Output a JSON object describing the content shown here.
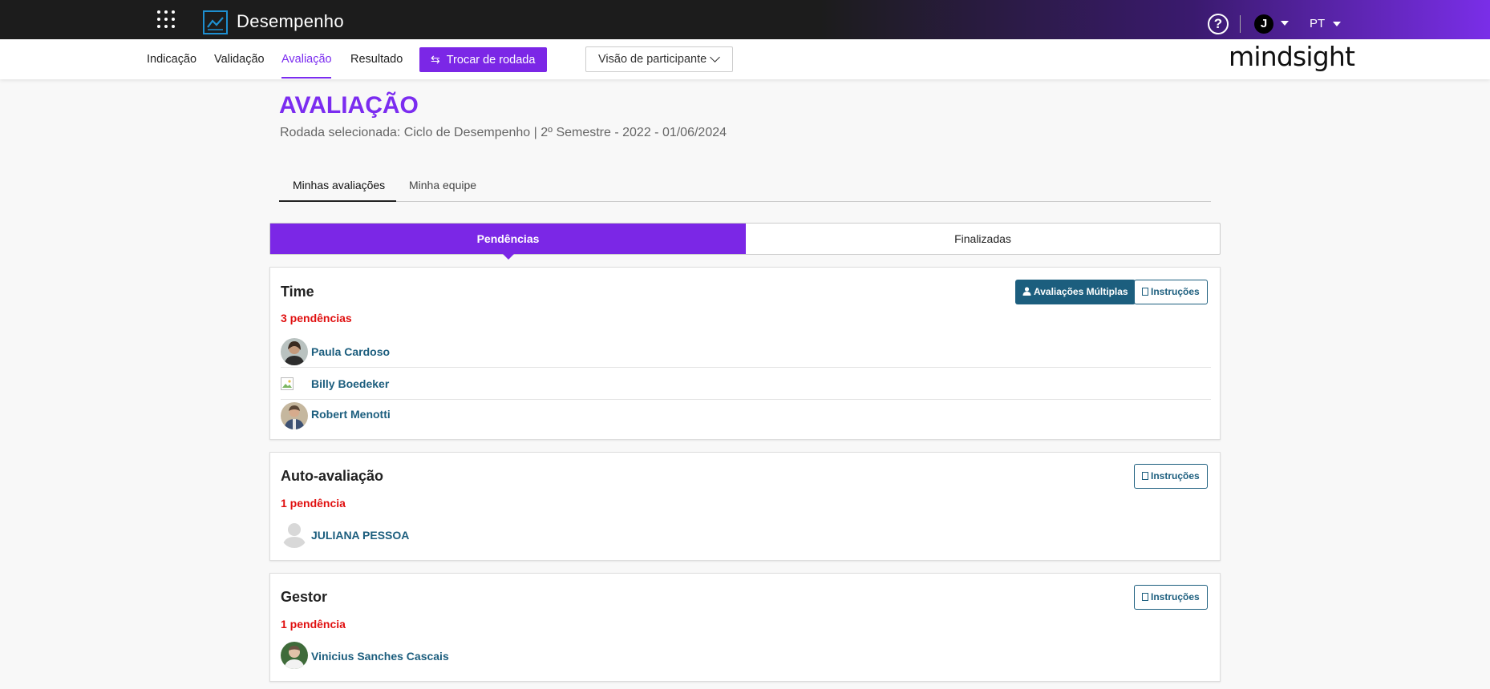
{
  "header": {
    "app_title": "Desempenho",
    "help": "?",
    "user_initial": "J",
    "language": "PT"
  },
  "nav": {
    "items": [
      "Indicação",
      "Validação",
      "Avaliação",
      "Resultado"
    ],
    "active": "Avaliação",
    "trocar_label": "Trocar de rodada",
    "visao_label": "Visão de participante",
    "brand": "mindsight"
  },
  "page": {
    "title": "AVALIAÇÃO",
    "rodada": "Rodada selecionada: Ciclo de Desempenho | 2º Semestre - 2022 - 01/06/2024"
  },
  "subtabs": [
    "Minhas avaliações",
    "Minha equipe"
  ],
  "segments": [
    "Pendências",
    "Finalizadas"
  ],
  "sections": {
    "time": {
      "title": "Time",
      "count": "3 pendências",
      "multi_label": "Avaliações Múltiplas",
      "instr_label": "Instruções",
      "people": [
        "Paula Cardoso",
        "Billy Boedeker",
        "Robert Menotti"
      ]
    },
    "auto": {
      "title": "Auto-avaliação",
      "count": "1 pendência",
      "instr_label": "Instruções",
      "people": [
        "JULIANA PESSOA"
      ]
    },
    "gestor": {
      "title": "Gestor",
      "count": "1 pendência",
      "instr_label": "Instruções",
      "people": [
        "Vinicius Sanches Cascais"
      ]
    }
  },
  "colors": {
    "accent": "#7b27e6",
    "teal": "#1c5e7e",
    "alert": "#e01010"
  }
}
